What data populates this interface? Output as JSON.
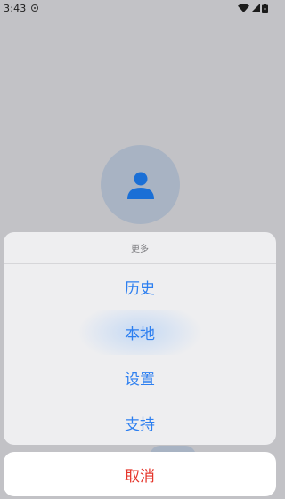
{
  "status_bar": {
    "time": "3:43"
  },
  "sheet": {
    "title": "更多",
    "items": [
      {
        "label": "历史"
      },
      {
        "label": "本地"
      },
      {
        "label": "设置"
      },
      {
        "label": "支持"
      }
    ],
    "cancel_label": "取消"
  },
  "colors": {
    "backdrop": "#c2c2c6",
    "accent": "#2d7ff0",
    "cancel": "#e5352b",
    "avatar_bg": "#a8b3c3",
    "avatar_icon": "#1a6fd6"
  },
  "icons": {
    "avatar": "person-icon",
    "vpn": "vpn-key-icon",
    "wifi": "wifi-icon",
    "signal": "cell-signal-icon",
    "battery": "battery-icon"
  }
}
